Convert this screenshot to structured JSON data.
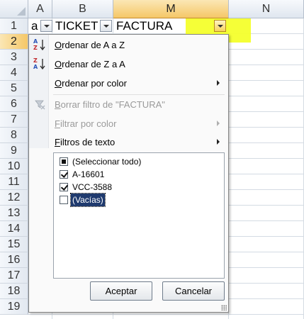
{
  "columns": [
    "A",
    "B",
    "M",
    "N"
  ],
  "rows": [
    "1",
    "2",
    "3",
    "4",
    "5",
    "6",
    "7",
    "8",
    "9",
    "10",
    "11",
    "12",
    "13",
    "14",
    "15",
    "16",
    "17",
    "18",
    "19"
  ],
  "row1": {
    "a": "a",
    "b": "TICKET",
    "m": "FACTURA"
  },
  "menu": {
    "sort_az": "Ordenar de A a Z",
    "sort_za": "Ordenar de Z a A",
    "sort_color": "Ordenar por color",
    "clear_filter": "Borrar filtro de \"FACTURA\"",
    "filter_color": "Filtrar por color",
    "text_filters": "Filtros de texto"
  },
  "list": [
    {
      "label": "(Seleccionar todo)",
      "state": "partial"
    },
    {
      "label": "A-16601",
      "state": "checked"
    },
    {
      "label": "VCC-3588",
      "state": "checked"
    },
    {
      "label": "(Vacías)",
      "state": "unchecked"
    }
  ],
  "buttons": {
    "ok": "Aceptar",
    "cancel": "Cancelar"
  },
  "icons": {
    "sort_az": "sort-az-icon",
    "sort_za": "sort-za-icon",
    "clear_filter": "clear-filter-icon"
  },
  "colors": {
    "highlight": "#f4ff2c",
    "selection": "#f5c767",
    "list_focus": "#1f3a6e"
  }
}
